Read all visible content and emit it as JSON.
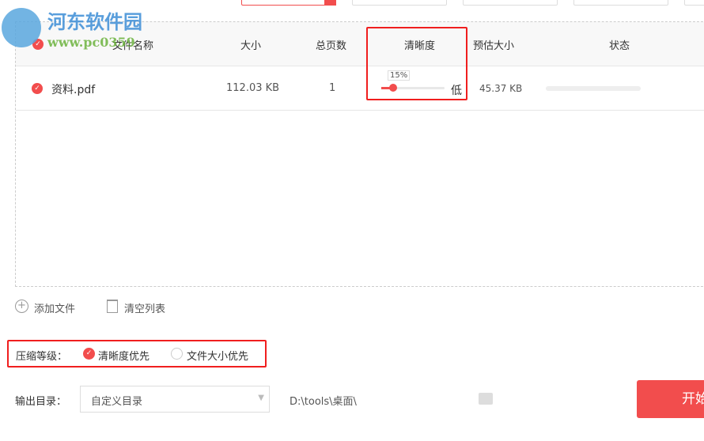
{
  "logo": {
    "name": "河东软件园",
    "url": "www.pc0359.cn"
  },
  "table": {
    "headers": {
      "name": "文件名称",
      "size": "大小",
      "pages": "总页数",
      "clarity": "清晰度",
      "est_size": "预估大小",
      "status": "状态"
    },
    "rows": [
      {
        "name": "资料.pdf",
        "size": "112.03 KB",
        "pages": "1",
        "clarity_percent": "15%",
        "clarity_label": "低",
        "est_size": "45.37 KB",
        "status_progress": 0
      }
    ]
  },
  "actions": {
    "add": "添加文件",
    "clear": "清空列表"
  },
  "compression": {
    "label": "压缩等级：",
    "options": [
      {
        "label": "清晰度优先",
        "selected": true
      },
      {
        "label": "文件大小优先",
        "selected": false
      }
    ]
  },
  "output": {
    "label": "输出目录：",
    "select_value": "自定义目录",
    "path": "D:\\tools\\桌面\\"
  },
  "start_button": "开始",
  "colors": {
    "accent": "#f24d4d",
    "highlight": "#f01e1e"
  }
}
